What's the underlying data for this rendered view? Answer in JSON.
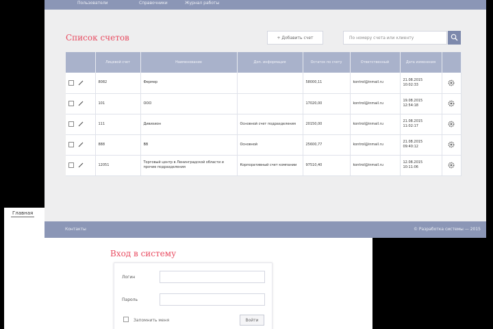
{
  "login_window": {
    "tab_stub": "Главная",
    "title": "Вход в систему",
    "login_label": "Логин",
    "password_label": "Пароль",
    "remember_label": "Запомнить меня",
    "submit_label": "Войти"
  },
  "main_window": {
    "nav": [
      "Пользователи",
      "Справочники",
      "Журнал работы"
    ],
    "title": "Список счетов",
    "add_button": "+ Добавить счет",
    "search_placeholder": "По номеру счета или клиенту",
    "columns": [
      "",
      "Лицевой счет",
      "Наименование",
      "Доп. информация",
      "Остаток по счету",
      "Ответственный",
      "Дата изменения",
      ""
    ],
    "rows": [
      {
        "account": "8082",
        "name": "Фермер",
        "info": "",
        "balance": "58000,11",
        "responsible": "kontrol@inmail.ru",
        "date": "21.08.2015 10:02:33"
      },
      {
        "account": "101",
        "name": "ООО",
        "info": "",
        "balance": "17020,00",
        "responsible": "kontrol@inmail.ru",
        "date": "19.08.2015 12:54:18"
      },
      {
        "account": "111",
        "name": "Дивизион",
        "info": "Основной счет подразделения",
        "balance": "20150,00",
        "responsible": "kontrol@inmail.ru",
        "date": "21.08.2015 11:02:17"
      },
      {
        "account": "888",
        "name": "ВВ",
        "info": "Основной",
        "balance": "25600,77",
        "responsible": "kontrol@inmail.ru",
        "date": "21.08.2015 09:40:12"
      },
      {
        "account": "12051",
        "name": "Торговый центр в Ленинградской области и прочие подразделения",
        "info": "Корпоративный счет компании",
        "balance": "97510,40",
        "responsible": "kontrol@inmail.ru",
        "date": "12.08.2015 10:11:06"
      }
    ],
    "footer_left": "Контакты",
    "footer_right": "© Разработка системы — 2015"
  },
  "colors": {
    "accent": "#e84a5f",
    "nav_bg": "#8b96b6",
    "table_header": "#a9b2cb"
  }
}
